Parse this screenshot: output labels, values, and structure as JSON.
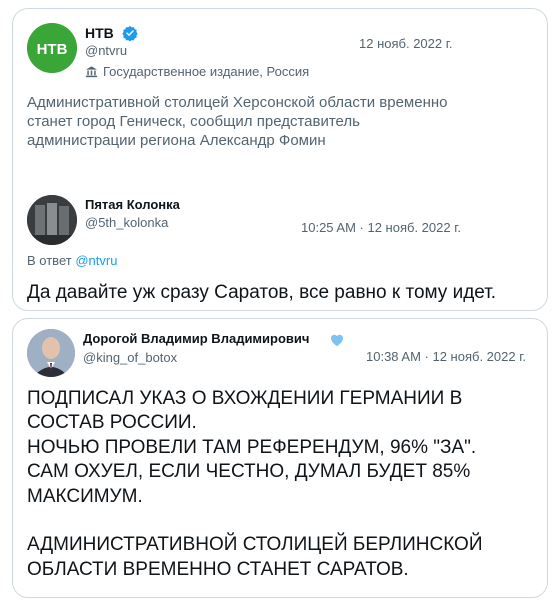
{
  "tweet1": {
    "name": "НТВ",
    "handle": "@ntvru",
    "date": "12 нояб. 2022 г.",
    "label": "Государственное издание, Россия",
    "text": "Административной столицей Херсонской области временно\nстанет город Геническ, сообщил представитель\nадминистрации региона Александр Фомин",
    "logo": "НТВ"
  },
  "tweet2": {
    "name": "Пятая Колонка",
    "handle": "@5th_kolonka",
    "time": "10:25 AM · 12 нояб. 2022 г.",
    "reply_prefix": "В ответ",
    "reply_handle": "@ntvru",
    "text": "Да давайте уж сразу Саратов, все равно к тому идет."
  },
  "tweet3": {
    "name": "Дорогой Владимир Владимирович",
    "handle": "@king_of_botox",
    "time": "10:38 AM · 12 нояб. 2022 г.",
    "text": "ПОДПИСАЛ УКАЗ О ВХОЖДЕНИИ ГЕРМАНИИ В\nСОСТАВ РОССИИ.\nНОЧЬЮ ПРОВЕЛИ ТАМ РЕФЕРЕНДУМ, 96% \"ЗА\".\nСАМ ОХУЕЛ, ЕСЛИ ЧЕСТНО, ДУМАЛ БУДЕТ 85%\nМАКСИМУМ.\n\nАДМИНИСТРАТИВНОЙ СТОЛИЦЕЙ БЕРЛИНСКОЙ\nОБЛАСТИ ВРЕМЕННО СТАНЕТ САРАТОВ."
  },
  "colors": {
    "border": "#cfd9de",
    "secondary_text": "#536471",
    "link": "#1d9bf0",
    "verified_gold": "#1d9bf0",
    "heart_badge": "#7cc2f2",
    "ntv_green": "#2e9e2f"
  }
}
